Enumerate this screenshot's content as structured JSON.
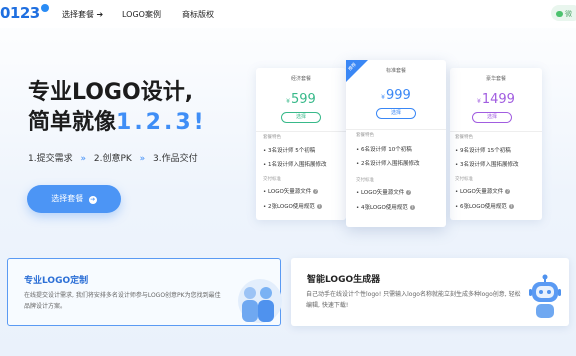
{
  "nav": {
    "logo_text": "0123",
    "items": [
      "选择套餐 ➔",
      "LOGO案例",
      "商标版权"
    ],
    "wechat_label": "微"
  },
  "hero": {
    "title_line1": "专业LOGO设计,",
    "title_line2_prefix": "简单就像",
    "title_line2_highlight": "1.2.3!",
    "step1": "1.提交需求",
    "step2": "2.创意PK",
    "step3": "3.作品交付",
    "arrow": "»",
    "cta_label": "选择套餐",
    "cta_icon": "➔"
  },
  "pricing": {
    "currency": "¥",
    "ribbon": "推荐",
    "select_label": "选择",
    "section_design": "套餐特色",
    "section_delivery": "交付标准",
    "plans": [
      {
        "name": "经济套餐",
        "price": "599",
        "color": "#38b98a",
        "features": [
          "3名设计师 5个初稿",
          "1名设计师入围拓展修改"
        ],
        "deliverables": [
          "LOGO矢量源文件",
          "2张LOGO使用规范"
        ]
      },
      {
        "name": "标准套餐",
        "price": "999",
        "color": "#3a87f5",
        "features": [
          "6名设计师 10个初稿",
          "2名设计师入围拓展修改"
        ],
        "deliverables": [
          "LOGO矢量源文件",
          "4张LOGO使用规范"
        ]
      },
      {
        "name": "豪华套餐",
        "price": "1499",
        "color": "#a15de0",
        "features": [
          "9名设计师 15个初稿",
          "3名设计师入围拓展修改"
        ],
        "deliverables": [
          "LOGO矢量源文件",
          "6张LOGO使用规范"
        ]
      }
    ]
  },
  "features": [
    {
      "title": "专业LOGO定制",
      "desc": "在线提交设计需求, 我们将安排多名设计师参与LOGO创意PK为您找到最佳品牌设计方案。"
    },
    {
      "title": "智能LOGO生成器",
      "desc": "自己动手在线设计个性logo! 只需输入logo名称就能立刻生成多种logo创意, 轻松编辑, 快速下载!"
    }
  ],
  "colors": {
    "accent": "#3f8ef6",
    "economy": "#38b98a",
    "standard": "#3a87f5",
    "luxury": "#a15de0"
  }
}
